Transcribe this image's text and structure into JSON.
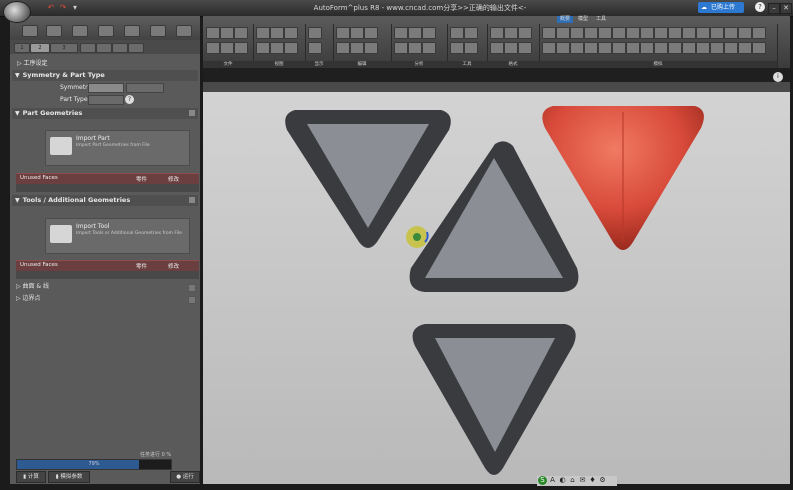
{
  "window": {
    "title": "AutoForm^plus R8 - www.cncad.com分享>>正确的输出文件<-",
    "badge": "已购上传",
    "controls": {
      "help": "?",
      "minimize": "–",
      "restore": "▫",
      "close": "✕"
    }
  },
  "quick_access": [
    "↶",
    "↷",
    "▾"
  ],
  "ribbon": {
    "tabs": [
      "概要",
      "模型",
      "工具"
    ],
    "groups": [
      "文件",
      "视图",
      "显示",
      "编辑",
      "分析",
      "工具",
      "格式",
      "模拟"
    ]
  },
  "left_panel": {
    "tabs": [
      "1",
      "2",
      "3"
    ],
    "crumb": "▷ 工序设定",
    "sections": [
      {
        "title": "Symmetry & Part Type",
        "rows": [
          {
            "label": "Symmetry"
          },
          {
            "label": "Part Type"
          }
        ]
      },
      {
        "title": "Part Geometries",
        "card": {
          "title": "Import Part",
          "subtitle": "Import Part Geometries from File"
        },
        "bar": {
          "left": "Unused Faces",
          "mid": "零件",
          "right": "修改"
        }
      },
      {
        "title": "Tools / Additional Geometries",
        "card": {
          "title": "Import Tool",
          "subtitle": "Import Tools or Additional Geometries from File"
        },
        "bar": {
          "left": "Unused Faces",
          "mid": "零件",
          "right": "修改"
        }
      }
    ],
    "list": [
      {
        "label": "▷ 曲面 & 线"
      },
      {
        "label": "▷ 边界点"
      }
    ],
    "progress": {
      "label": "79%",
      "fraction": 0.79,
      "caption": "任务进行 0 %"
    },
    "buttons": [
      "▮ 计算",
      "▮ 模拟参数",
      "● 运行"
    ]
  },
  "viewport": {
    "status_icons": [
      "S",
      "A",
      "◐",
      "⌂",
      "✉",
      "♦",
      "⚙"
    ],
    "shapes": [
      {
        "id": "tri-gray-down-left",
        "color": "#8b8f95",
        "rim": "#3a3b3e"
      },
      {
        "id": "tri-gray-up-center",
        "color": "#8b8f95",
        "rim": "#3a3b3e"
      },
      {
        "id": "tri-red-down-right",
        "color": "#d84a3a",
        "rim": "#b83828"
      },
      {
        "id": "tri-gray-down-bottom",
        "color": "#8b8f95",
        "rim": "#3a3b3e"
      }
    ],
    "cursor_color": "#c8c23a"
  },
  "colors": {
    "accent": "#2d79d2",
    "red": "#d84a3a",
    "panel": "#5a5a5a"
  }
}
